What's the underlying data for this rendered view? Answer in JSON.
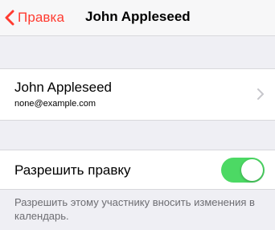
{
  "colors": {
    "accent": "#ff3b30",
    "toggle_on": "#4cd964",
    "background": "#efeff4"
  },
  "navbar": {
    "back_label": "Правка",
    "back_icon": "chevron-left-icon",
    "title": "John Appleseed"
  },
  "contact": {
    "name": "John Appleseed",
    "email": "none@example.com",
    "disclosure_icon": "chevron-right-icon"
  },
  "permission": {
    "label": "Разрешить правку",
    "enabled": true,
    "footer": "Разрешить этому участнику вносить изменения в календарь."
  }
}
